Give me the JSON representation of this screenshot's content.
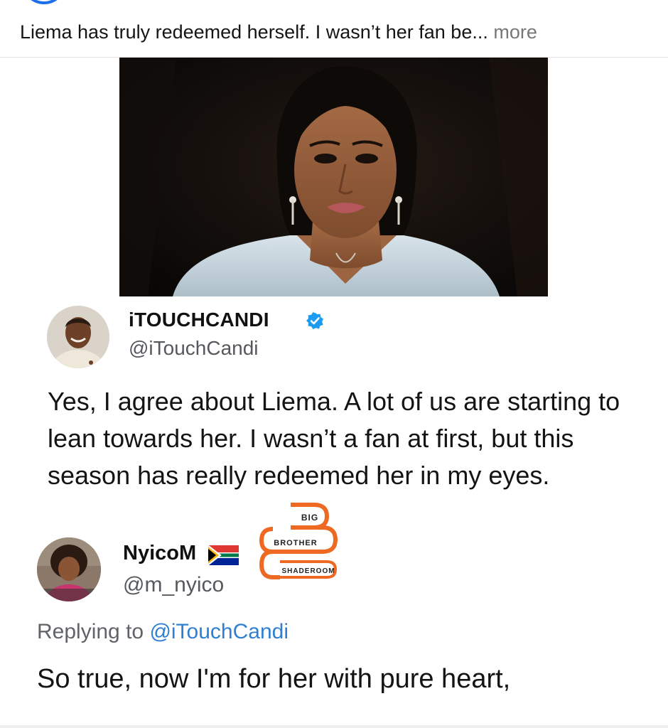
{
  "post": {
    "caption_text": "Liema has truly redeemed herself. I wasn’t her fan be...",
    "more_label": "more"
  },
  "tweet": {
    "display_name": "iTOUCHCANDI",
    "handle": "@iTouchCandi",
    "verified_icon": "verified-badge-icon",
    "body": "Yes, I agree about Liema. A lot of us are starting to lean towards her. I wasn’t a fan at first, but this season has really redeemed her in my eyes."
  },
  "watermark": {
    "line1": "BIG",
    "line2": "BROTHER",
    "line3": "SHADEROOM",
    "color": "#ee6a22"
  },
  "reply": {
    "display_name": "NyicoM",
    "flag_icon": "south-africa-flag-icon",
    "handle": "@m_nyico",
    "replying_to_prefix": "Replying to ",
    "replying_to_handle": "@iTouchCandi",
    "body": "So true, now I'm for her with pure heart,"
  },
  "colors": {
    "accent": "#2f7fd3",
    "verified": "#1d9bf0",
    "secondary_text": "#55595e"
  }
}
